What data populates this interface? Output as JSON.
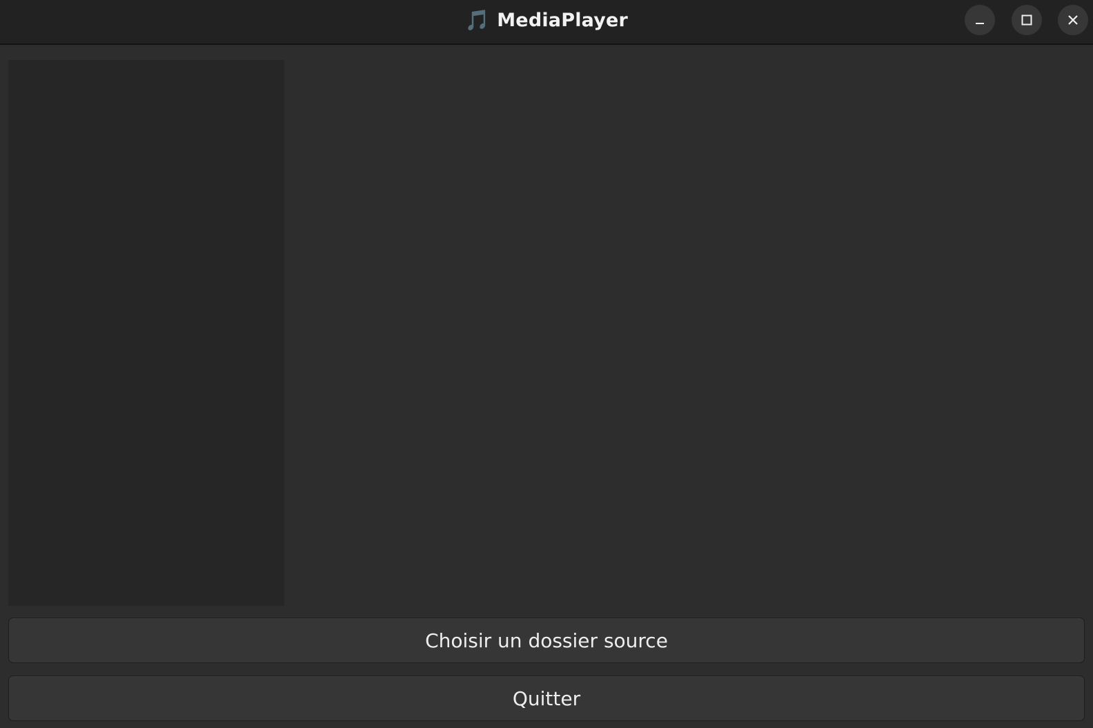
{
  "window": {
    "title": "MediaPlayer",
    "app_icon": "music-note-icon",
    "app_icon_glyph": "🎵",
    "controls": {
      "minimize": "minimize-icon",
      "maximize": "maximize-icon",
      "close": "close-icon"
    }
  },
  "actions": {
    "choose_folder_label": "Choisir un dossier source",
    "quit_label": "Quitter"
  },
  "colors": {
    "background": "#2d2d2d",
    "titlebar": "#222222",
    "sidebar": "#262626",
    "button": "#363636",
    "text": "#eeeeee"
  }
}
